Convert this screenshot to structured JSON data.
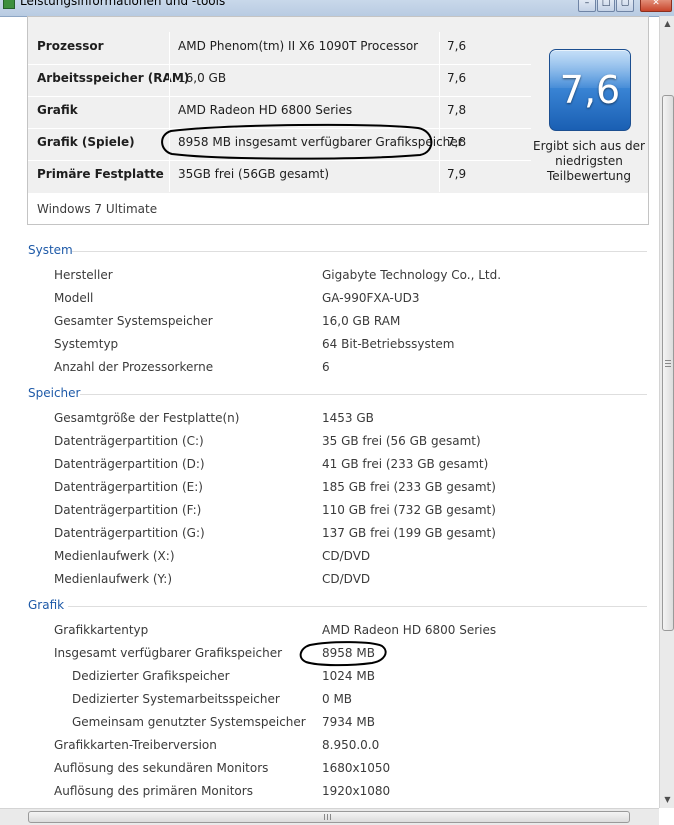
{
  "window": {
    "title": "Leistungsinformationen und -tools"
  },
  "score_table": {
    "rows": [
      {
        "component": "Prozessor",
        "detail": "AMD Phenom(tm) II X6 1090T Processor",
        "score": "7,6"
      },
      {
        "component": "Arbeitsspeicher (RAM)",
        "detail": "16,0 GB",
        "score": "7,6"
      },
      {
        "component": "Grafik",
        "detail": "AMD Radeon HD 6800 Series",
        "score": "7,8"
      },
      {
        "component": "Grafik (Spiele)",
        "detail": "8958 MB insgesamt verfügbarer Grafikspeicher",
        "score": "7,8"
      },
      {
        "component": "Primäre Festplatte",
        "detail": "35GB frei (56GB gesamt)",
        "score": "7,9"
      }
    ],
    "base_score": "7,6",
    "base_score_caption": "Ergibt sich aus der niedrigsten Teilbewertung",
    "edition": "Windows 7 Ultimate"
  },
  "sections": {
    "system": {
      "title": "System",
      "items": [
        {
          "label": "Hersteller",
          "value": "Gigabyte Technology Co., Ltd."
        },
        {
          "label": "Modell",
          "value": "GA-990FXA-UD3"
        },
        {
          "label": "Gesamter Systemspeicher",
          "value": "16,0 GB RAM"
        },
        {
          "label": "Systemtyp",
          "value": "64 Bit-Betriebssystem"
        },
        {
          "label": "Anzahl der Prozessorkerne",
          "value": "6"
        }
      ]
    },
    "speicher": {
      "title": "Speicher",
      "items": [
        {
          "label": "Gesamtgröße der Festplatte(n)",
          "value": "1453 GB"
        },
        {
          "label": "Datenträgerpartition (C:)",
          "value": "35 GB frei (56 GB gesamt)"
        },
        {
          "label": "Datenträgerpartition (D:)",
          "value": "41 GB frei (233 GB gesamt)"
        },
        {
          "label": "Datenträgerpartition (E:)",
          "value": "185 GB frei (233 GB gesamt)"
        },
        {
          "label": "Datenträgerpartition (F:)",
          "value": "110 GB frei (732 GB gesamt)"
        },
        {
          "label": "Datenträgerpartition (G:)",
          "value": "137 GB frei (199 GB gesamt)"
        },
        {
          "label": "Medienlaufwerk (X:)",
          "value": "CD/DVD"
        },
        {
          "label": "Medienlaufwerk (Y:)",
          "value": "CD/DVD"
        }
      ]
    },
    "grafik": {
      "title": "Grafik",
      "items": [
        {
          "label": "Grafikkartentyp",
          "value": "AMD Radeon HD 6800 Series"
        },
        {
          "label": "Insgesamt verfügbarer Grafikspeicher",
          "value": "8958 MB"
        },
        {
          "label": "Dedizierter Grafikspeicher",
          "value": "1024 MB"
        },
        {
          "label": "Dedizierter Systemarbeitsspeicher",
          "value": "0 MB"
        },
        {
          "label": "Gemeinsam genutzter Systemspeicher",
          "value": "7934 MB"
        },
        {
          "label": "Grafikkarten-Treiberversion",
          "value": "8.950.0.0"
        },
        {
          "label": "Auflösung des sekundären Monitors",
          "value": "1680x1050"
        },
        {
          "label": "Auflösung des primären Monitors",
          "value": "1920x1080"
        }
      ]
    }
  },
  "colors": {
    "section_title": "#1e5aa8",
    "badge": "#3b86d6",
    "annotation": "#000000"
  }
}
